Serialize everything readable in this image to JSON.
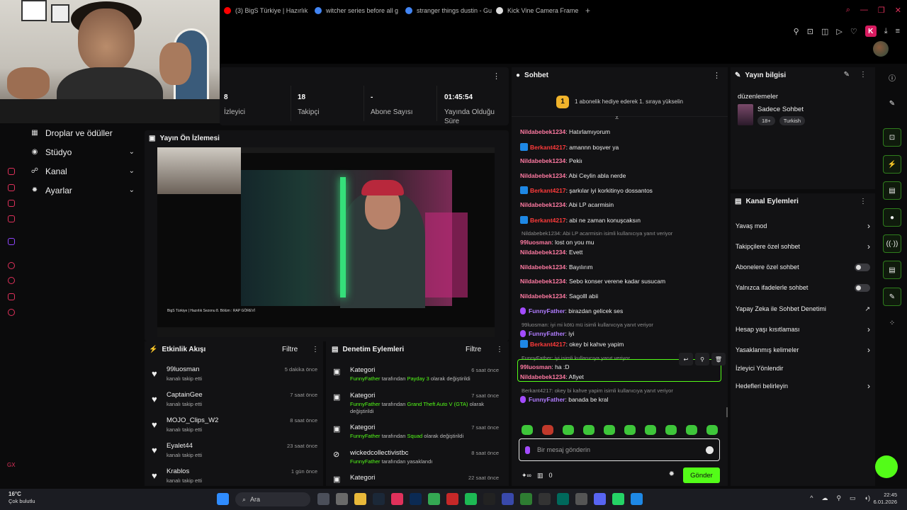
{
  "browser": {
    "tabs": [
      {
        "title": "(3) BigS Türkiye | Hazırlık",
        "color": "#ff0000"
      },
      {
        "title": "witcher series before all g",
        "color": "#4285f4"
      },
      {
        "title": "stranger things dustin - Gu",
        "color": "#4285f4"
      },
      {
        "title": "Kick Vine Camera Frame",
        "color": "#dddddd"
      }
    ],
    "new_tab": "+",
    "profile_letter": "K"
  },
  "sidenav": {
    "items": [
      {
        "label": "Droplar ve ödüller",
        "icon": "gift-icon"
      },
      {
        "label": "Stüdyo",
        "icon": "studio-icon",
        "chevron": "⌄"
      },
      {
        "label": "Kanal",
        "icon": "channel-icon",
        "chevron": "⌄"
      },
      {
        "label": "Ayarlar",
        "icon": "gear-icon",
        "chevron": "⌄"
      }
    ]
  },
  "stats": {
    "items": [
      {
        "value": "8",
        "label": "İzleyici"
      },
      {
        "value": "18",
        "label": "Takipçi"
      },
      {
        "value": "-",
        "label": "Abone Sayısı"
      },
      {
        "value": "01:45:54",
        "label": "Yayında Olduğu Süre"
      }
    ]
  },
  "preview": {
    "title": "Yayın Ön İzlemesi",
    "caption": "BigS Türkiye | Hazırlık Sezonu 8. Bölüm : RAP GÖREVİ"
  },
  "activity": {
    "title": "Etkinlik Akışı",
    "filter": "Filtre",
    "items": [
      {
        "name": "99luosman",
        "sub": "kanalı takip etti",
        "time": "5 dakika önce"
      },
      {
        "name": "CaptainGee",
        "sub": "kanalı takip etti",
        "time": "7 saat önce"
      },
      {
        "name": "MOJO_Clips_W2",
        "sub": "kanalı takip etti",
        "time": "8 saat önce"
      },
      {
        "name": "Eyalet44",
        "sub": "kanalı takip etti",
        "time": "23 saat önce"
      },
      {
        "name": "Krablos",
        "sub": "kanalı takip etti",
        "time": "1 gün önce"
      }
    ]
  },
  "moderation": {
    "title": "Denetim Eylemleri",
    "filter": "Filtre",
    "items": [
      {
        "title": "Kategori",
        "time": "6 saat önce",
        "actor": "FunnyFather",
        "mid": " tarafından ",
        "target": "Payday 3",
        "end": " olarak değiştirildi"
      },
      {
        "title": "Kategori",
        "time": "7 saat önce",
        "actor": "FunnyFather",
        "mid": " tarafından ",
        "target": "Grand Theft Auto V (GTA)",
        "end": " olarak değiştirildi"
      },
      {
        "title": "Kategori",
        "time": "7 saat önce",
        "actor": "FunnyFather",
        "mid": " tarafından ",
        "target": "Squad",
        "end": " olarak değiştirildi"
      },
      {
        "title": "wickedcollectivistbc",
        "time": "8 saat önce",
        "actor": "FunnyFather",
        "mid": " tarafından yasaklandı",
        "target": "",
        "end": ""
      },
      {
        "title": "Kategori",
        "time": "22 saat önce",
        "actor": "",
        "mid": "",
        "target": "",
        "end": ""
      }
    ]
  },
  "chat": {
    "title": "Sohbet",
    "pinned_rank": "1",
    "pinned_text": "1 abonelik hediye ederek 1. sıraya yükselin",
    "input_placeholder": "Bir mesaj gönderin",
    "points": "0",
    "send_label": "Gönder",
    "messages": [
      {
        "user": "Nildabebek1234",
        "color": "pink",
        "text": "Hatırlamıyorum"
      },
      {
        "user": "Berkant4217",
        "color": "red",
        "badge": "kick",
        "text": "amannn boşver ya"
      },
      {
        "user": "Nildabebek1234",
        "color": "pink",
        "text": "Pekiı"
      },
      {
        "user": "Nildabebek1234",
        "color": "pink",
        "text": "Abi Ceylin abla nerde"
      },
      {
        "user": "Berkant4217",
        "color": "red",
        "badge": "kick",
        "text": "şarkılar iyi korkitinyo dossantos"
      },
      {
        "user": "Nildabebek1234",
        "color": "pink",
        "text": "Abi LP acarmisin"
      },
      {
        "user": "Berkant4217",
        "color": "red",
        "badge": "kick",
        "text": "abi ne zaman konuşcaksın"
      },
      {
        "reply": "Nildabebek1234: Abi LP acarmisin isimli kullanıcıya yanıt veriyor",
        "user": "99luosman",
        "color": "pink",
        "text": "lost on you mu"
      },
      {
        "user": "Nildabebek1234",
        "color": "pink",
        "text": "Evett"
      },
      {
        "user": "Nildabebek1234",
        "color": "pink",
        "text": "Bayılırım"
      },
      {
        "user": "Nildabebek1234",
        "color": "pink",
        "text": "Sebo konser verene kadar susucam"
      },
      {
        "user": "Nildabebek1234",
        "color": "pink",
        "text": "Sagolll abii"
      },
      {
        "user": "FunnyFather",
        "color": "purple",
        "badge": "mic",
        "text": "birazdan gelicek ses"
      },
      {
        "reply": "99luosman: iyi mi kötü mü isimli kullanıcıya yanıt veriyor",
        "user": "FunnyFather",
        "color": "purple",
        "badge": "mic",
        "text": "iyi"
      },
      {
        "user": "Berkant4217",
        "color": "red",
        "badge": "kick",
        "text": "okey bi kahve yapim"
      },
      {
        "reply": "FunnyFather: iyi isimli kullanıcıya yanıt veriyor",
        "user": "99luosman",
        "color": "pink",
        "text": "ha :D"
      },
      {
        "user": "Nildabebek1234",
        "color": "pink",
        "text": "Afiyet"
      },
      {
        "reply": "Berkant4217: okey bi kahve yapim isimli kullanıcıya yanıt veriyor",
        "user": "FunnyFather",
        "color": "purple",
        "badge": "mic",
        "text": "banada be kral"
      }
    ]
  },
  "stream_info": {
    "title": "Yayın bilgisi",
    "stream_title": "düzenlemeler",
    "category": "Sadece Sohbet",
    "tags": [
      "18+",
      "Turkish"
    ]
  },
  "channel_actions": {
    "title": "Kanal Eylemleri",
    "rows": [
      {
        "label": "Yavaş mod",
        "kind": "chevron"
      },
      {
        "label": "Takipçilere özel sohbet",
        "kind": "chevron"
      },
      {
        "label": "Abonelere özel sohbet",
        "kind": "toggle"
      },
      {
        "label": "Yalnızca ifadelerle sohbet",
        "kind": "toggle"
      },
      {
        "label": "Yapay Zeka ile Sohbet Denetimi",
        "kind": "external"
      },
      {
        "label": "Hesap yaşı kısıtlaması",
        "kind": "chevron"
      },
      {
        "label": "Yasaklanmış kelimeler",
        "kind": "chevron"
      },
      {
        "label": "İzleyici Yönlendir",
        "kind": "none"
      },
      {
        "label": "Hedefleri belirleyin",
        "kind": "chevron"
      }
    ]
  },
  "taskbar": {
    "temp": "16°C",
    "weather": "Çok bulutlu",
    "search": "Ara",
    "time": "22:45",
    "date": "6.01.2026"
  },
  "colors": {
    "accent": "#53fc18",
    "brand_red": "#e0315b"
  }
}
